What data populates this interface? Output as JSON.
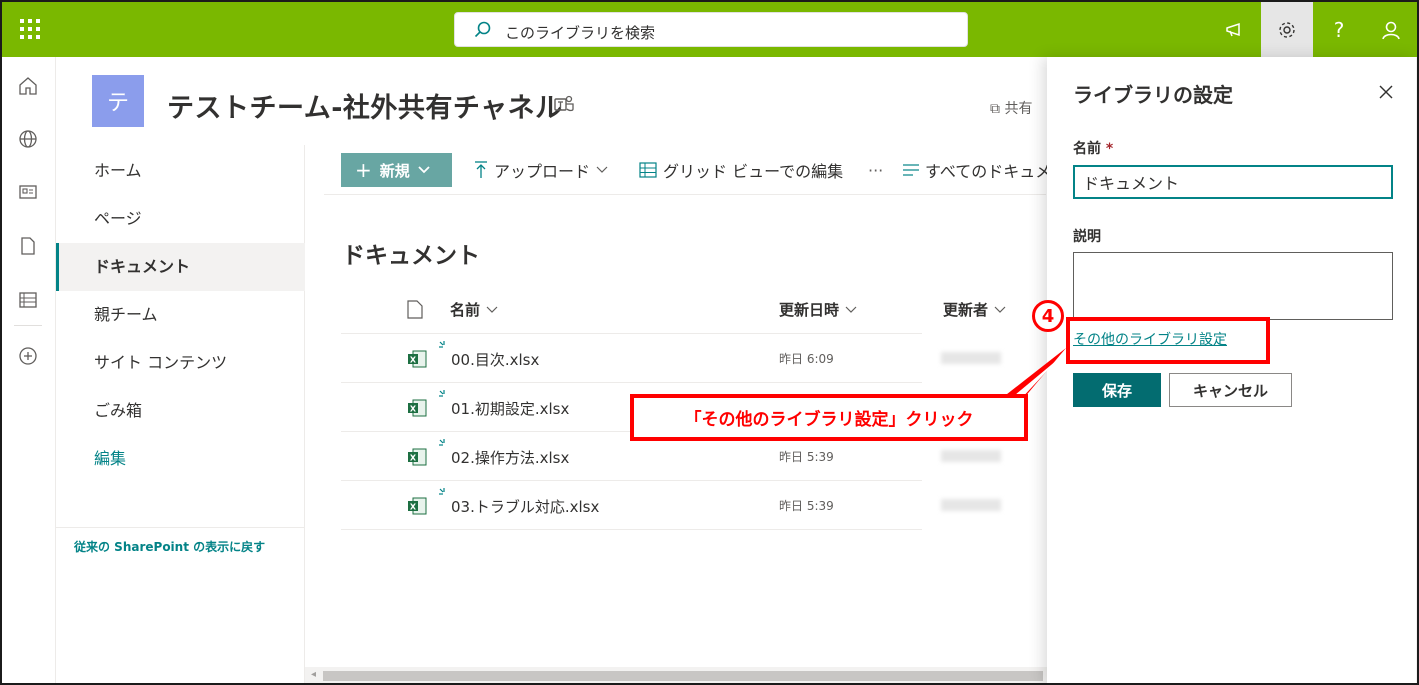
{
  "topbar": {
    "search_placeholder": "このライブラリを検索",
    "help_label": "?"
  },
  "site": {
    "logo_letter": "テ",
    "title": "テストチーム-社外共有チャネル",
    "share_label": "共有"
  },
  "nav": {
    "items": [
      {
        "label": "ホーム"
      },
      {
        "label": "ページ"
      },
      {
        "label": "ドキュメント",
        "selected": true
      },
      {
        "label": "親チーム"
      },
      {
        "label": "サイト コンテンツ"
      },
      {
        "label": "ごみ箱"
      }
    ],
    "edit_label": "編集",
    "back_label": "従来の SharePoint の表示に戻す"
  },
  "commands": {
    "new_label": "新規",
    "upload_label": "アップロード",
    "grid_label": "グリッド ビューでの編集",
    "more_label": "···",
    "view_label": "すべてのドキュメ"
  },
  "library": {
    "title": "ドキュメント",
    "columns": {
      "name": "名前",
      "modified": "更新日時",
      "modified_by": "更新者"
    },
    "files": [
      {
        "name": "00.目次.xlsx",
        "modified": "昨日 6:09"
      },
      {
        "name": "01.初期設定.xlsx",
        "modified": ""
      },
      {
        "name": "02.操作方法.xlsx",
        "modified": "昨日 5:39"
      },
      {
        "name": "03.トラブル対応.xlsx",
        "modified": "昨日 5:39"
      }
    ]
  },
  "panel": {
    "title": "ライブラリの設定",
    "name_label": "名前",
    "required_mark": "*",
    "name_value": "ドキュメント",
    "desc_label": "説明",
    "more_settings_link": "その他のライブラリ設定",
    "save_label": "保存",
    "cancel_label": "キャンセル"
  },
  "annotation": {
    "step_number": "4",
    "callout_text": "「その他のライブラリ設定」クリック"
  },
  "colors": {
    "topbar": "#7ab800",
    "accent": "#038387",
    "primary_button": "#036c70",
    "annotation": "#ff0000"
  }
}
